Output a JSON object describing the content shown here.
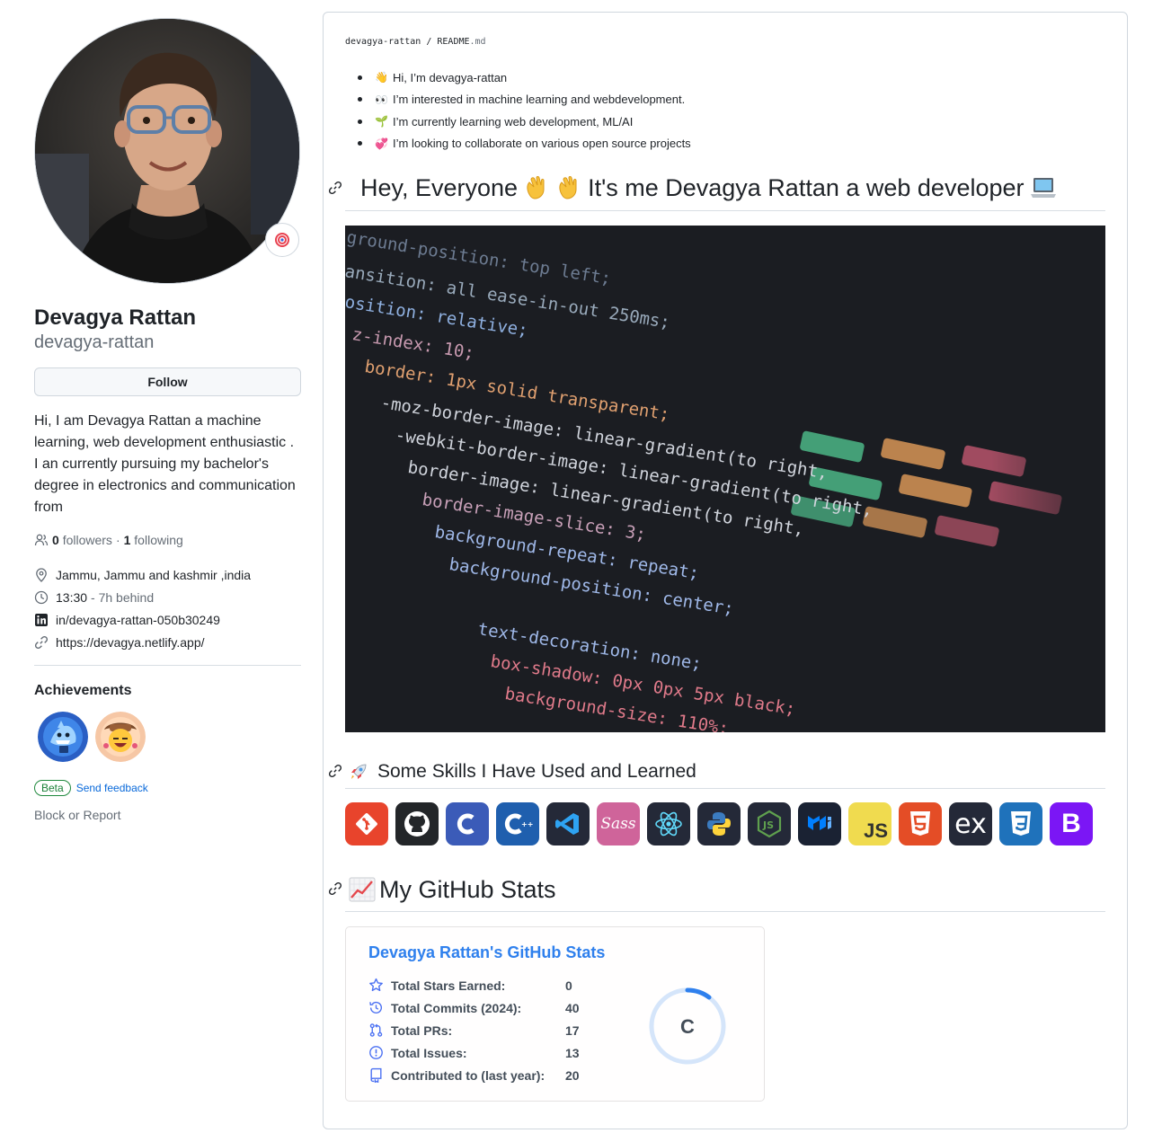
{
  "profile": {
    "full_name": "Devagya Rattan",
    "login": "devagya-rattan",
    "follow_label": "Follow",
    "bio": "Hi, I am Devagya Rattan a machine learning, web development enthusiastic . I an currently pursuing my bachelor's degree in electronics and communication from",
    "followers_count": "0",
    "followers_label": "followers",
    "separator": "·",
    "following_count": "1",
    "following_label": "following",
    "location": "Jammu, Jammu and kashmir ,india",
    "local_time": "13:30",
    "time_offset": "- 7h behind",
    "linkedin": "in/devagya-rattan-050b30249",
    "website": "https://devagya.netlify.app/",
    "achievements_title": "Achievements",
    "beta_label": "Beta",
    "send_feedback_label": "Send feedback",
    "block_report_label": "Block or Report"
  },
  "readme": {
    "path_owner": "devagya-rattan",
    "path_sep": "/",
    "path_file": "README",
    "path_ext": ".md",
    "intro_items": [
      {
        "emoji": "👋",
        "text": "Hi, I’m devagya-rattan"
      },
      {
        "emoji": "👀",
        "text": "I’m interested in machine learning and webdevelopment."
      },
      {
        "emoji": "🌱",
        "text": "I’m currently learning web development, ML/AI"
      },
      {
        "emoji": "💞️",
        "text": "I’m looking to collaborate on various open source projects"
      }
    ],
    "heading1": "Hey, Everyone",
    "heading1_rest": "It's me Devagya Rattan a web developer",
    "heading2": "Some Skills I Have Used and Learned",
    "heading3": "My GitHub Stats",
    "code_lines": [
      "ground-position: top left;",
      "ansition: all ease-in-out 250ms;",
      "osition: relative;",
      "z-index: 10;",
      "border: 1px solid transparent;",
      "-moz-border-image: linear-gradient(to right,",
      "-webkit-border-image: linear-gradient(to right,",
      "border-image: linear-gradient(to right,",
      "border-image-slice: 3;",
      "background-repeat: repeat;",
      "background-position: center;",
      "text-decoration: none;",
      "box-shadow: 0px 0px 5px black;",
      "background-size: 110%;"
    ],
    "skills": [
      "Git",
      "GitHub",
      "C",
      "C++",
      "VS Code",
      "Sass",
      "React",
      "Python",
      "Node.js",
      "Material UI",
      "JS",
      "HTML5",
      "Express",
      "CSS3",
      "Bootstrap"
    ]
  },
  "stats": {
    "title": "Devagya Rattan's GitHub Stats",
    "rows": [
      {
        "icon": "star-icon",
        "label": "Total Stars Earned:",
        "value": "0"
      },
      {
        "icon": "history-icon",
        "label": "Total Commits (2024):",
        "value": "40"
      },
      {
        "icon": "pull-request-icon",
        "label": "Total PRs:",
        "value": "17"
      },
      {
        "icon": "issue-icon",
        "label": "Total Issues:",
        "value": "13"
      },
      {
        "icon": "repo-icon",
        "label": "Contributed to (last year):",
        "value": "20"
      }
    ],
    "rank": "C",
    "colors": {
      "title": "#2f80ed",
      "text": "#434d58",
      "icon": "#4c71f2",
      "ring": "#2f80ed"
    }
  }
}
